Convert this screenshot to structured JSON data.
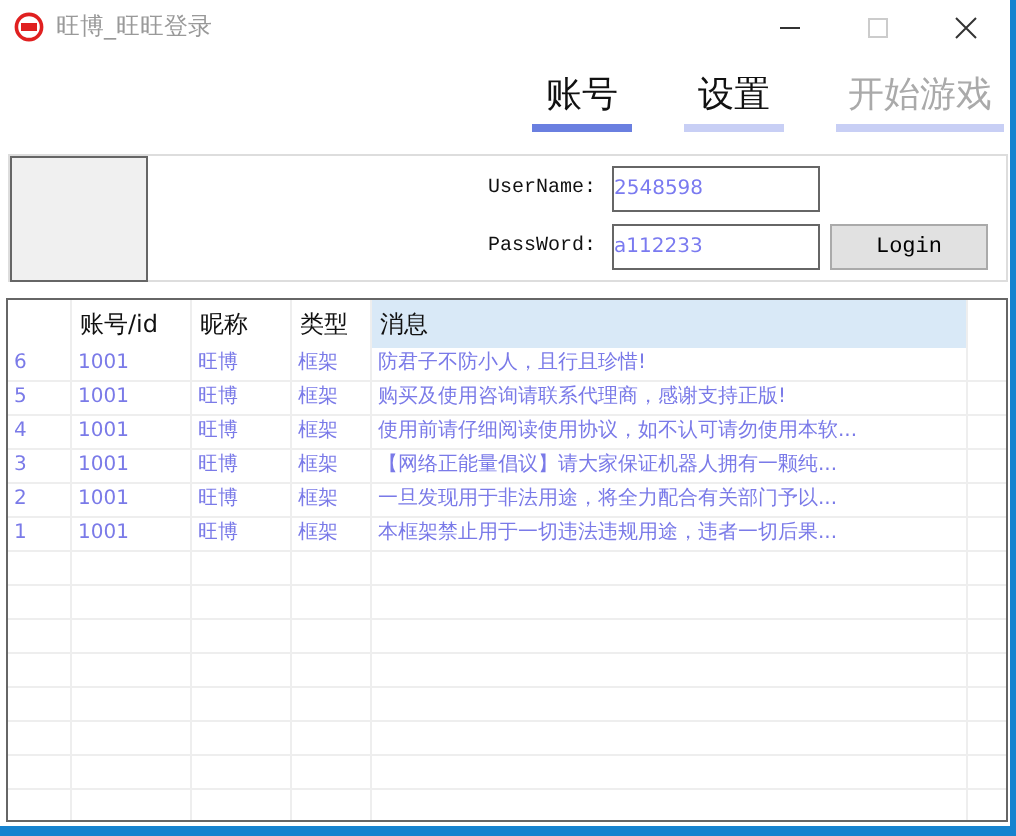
{
  "window": {
    "title": "旺博_旺旺登录"
  },
  "tabs": [
    {
      "label": "账号",
      "selected": true,
      "disabled": false
    },
    {
      "label": "设置",
      "selected": false,
      "disabled": false
    },
    {
      "label": "开始游戏",
      "selected": false,
      "disabled": true
    }
  ],
  "login": {
    "username_label": "UserName:",
    "username": "2548598",
    "password_label": "PassWord:",
    "password": "a112233",
    "button": "Login"
  },
  "table": {
    "columns": [
      "",
      "账号/id",
      "昵称",
      "类型",
      "消息"
    ],
    "rows": [
      [
        "6",
        "1001",
        "旺博",
        "框架",
        "防君子不防小人，且行且珍惜!"
      ],
      [
        "5",
        "1001",
        "旺博",
        "框架",
        "购买及使用咨询请联系代理商，感谢支持正版!"
      ],
      [
        "4",
        "1001",
        "旺博",
        "框架",
        "使用前请仔细阅读使用协议，如不认可请勿使用本软..."
      ],
      [
        "3",
        "1001",
        "旺博",
        "框架",
        "【网络正能量倡议】请大家保证机器人拥有一颗纯..."
      ],
      [
        "2",
        "1001",
        "旺博",
        "框架",
        "一旦发现用于非法用途，将全力配合有关部门予以..."
      ],
      [
        "1",
        "1001",
        "旺博",
        "框架",
        "本框架禁止用于一切违法违规用途，违者一切后果..."
      ]
    ]
  }
}
